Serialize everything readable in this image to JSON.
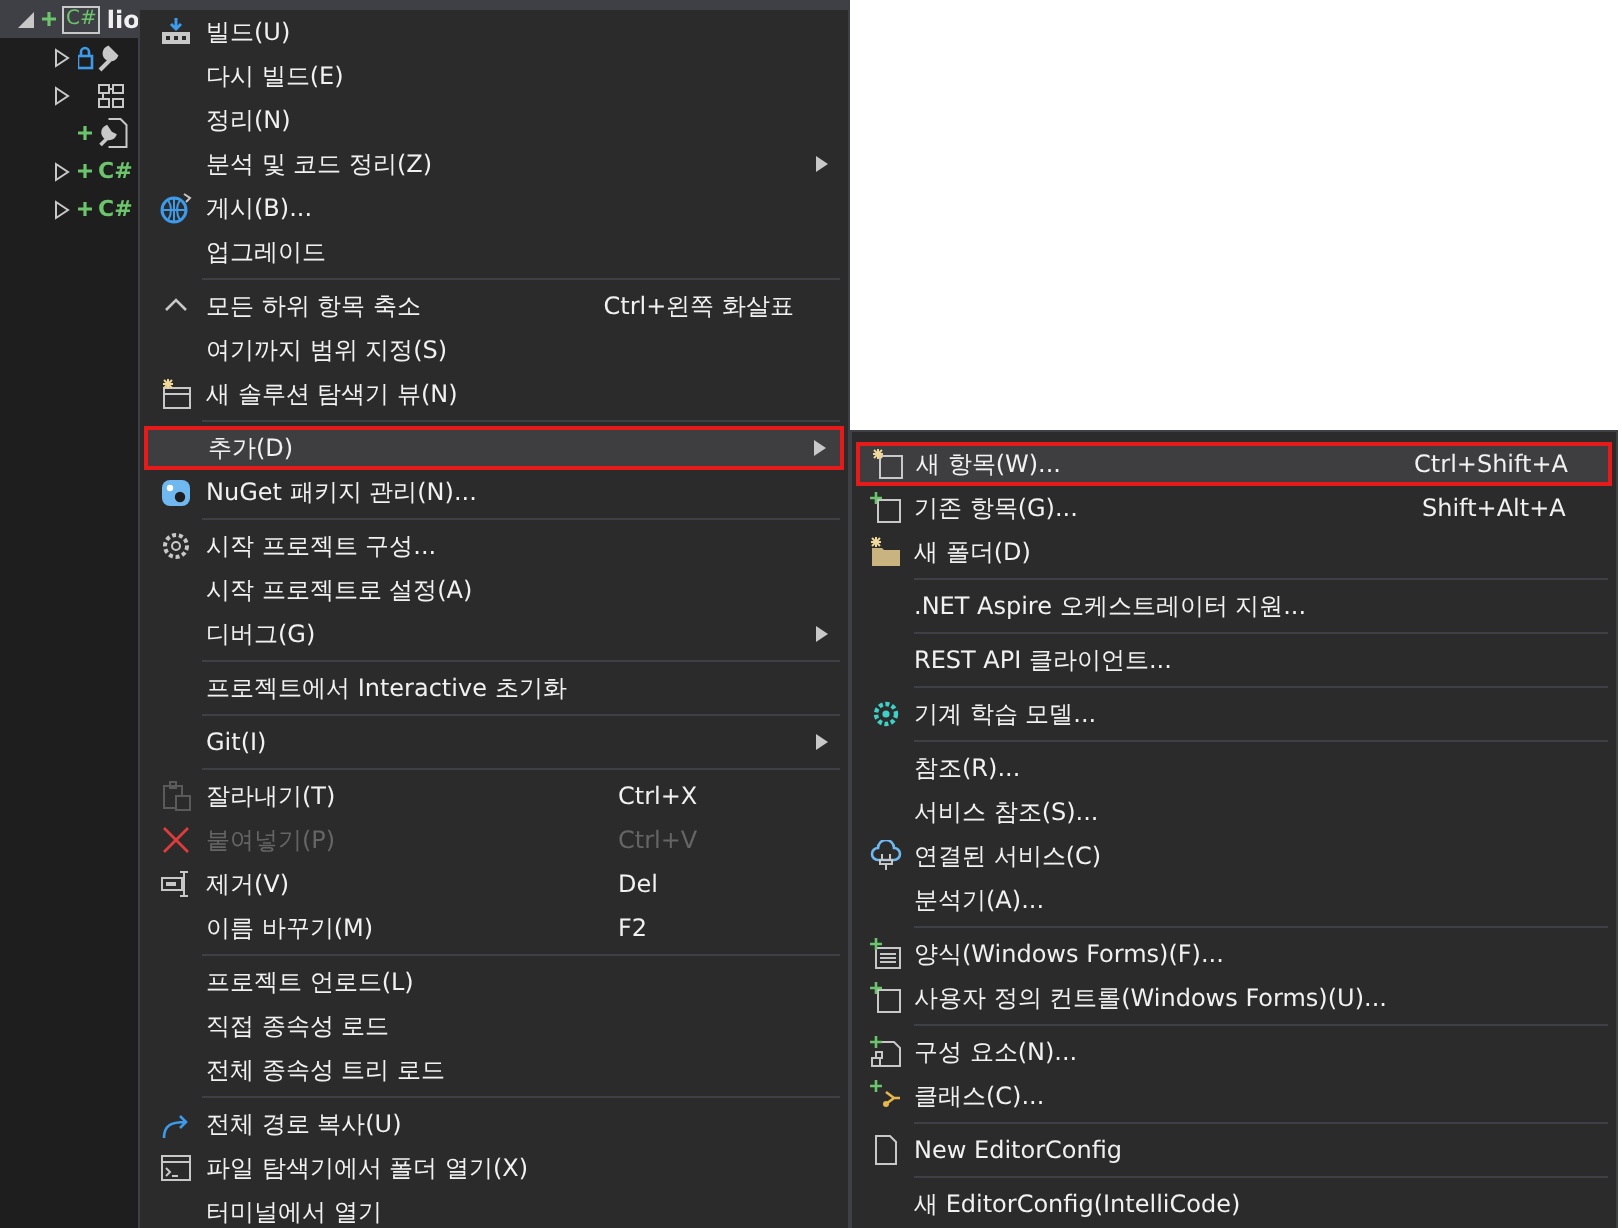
{
  "tree": [
    {
      "kind": "project",
      "badge": "C#",
      "label": "lio",
      "expanded": true,
      "selected": true,
      "children": [
        {
          "kind": "properties",
          "expanded": false
        },
        {
          "kind": "dependencies",
          "expanded": false
        },
        {
          "kind": "settings"
        },
        {
          "kind": "code",
          "badge": "C#",
          "expanded": false
        },
        {
          "kind": "code",
          "badge": "C#",
          "expanded": false
        }
      ]
    }
  ],
  "context_menu": {
    "items": [
      {
        "kind": "item",
        "label": "빌드(U)",
        "selected": false,
        "outlined": false,
        "disabled": false
      },
      {
        "kind": "item",
        "label": "다시 빌드(E)",
        "selected": false,
        "outlined": false,
        "disabled": false
      },
      {
        "kind": "item",
        "label": "정리(N)",
        "selected": false,
        "outlined": false,
        "disabled": false
      },
      {
        "kind": "item",
        "label": "분석 및 코드 정리(Z)",
        "submenu": true,
        "selected": false,
        "outlined": false,
        "disabled": false
      },
      {
        "kind": "item",
        "label": "게시(B)...",
        "selected": false,
        "outlined": false,
        "disabled": false
      },
      {
        "kind": "item",
        "label": "업그레이드",
        "selected": false,
        "outlined": false,
        "disabled": false
      },
      {
        "kind": "separator"
      },
      {
        "kind": "item",
        "label": "모든 하위 항목 축소",
        "shortcut": "Ctrl+왼쪽 화살표",
        "selected": false,
        "outlined": false,
        "disabled": false
      },
      {
        "kind": "item",
        "label": "여기까지 범위 지정(S)",
        "selected": false,
        "outlined": false,
        "disabled": false
      },
      {
        "kind": "item",
        "label": "새 솔루션 탐색기 뷰(N)",
        "selected": false,
        "outlined": false,
        "disabled": false
      },
      {
        "kind": "separator"
      },
      {
        "kind": "item",
        "label": "추가(D)",
        "submenu": true,
        "selected": true,
        "outlined": true,
        "disabled": false
      },
      {
        "kind": "item",
        "label": "NuGet 패키지 관리(N)...",
        "selected": false,
        "outlined": false,
        "disabled": false
      },
      {
        "kind": "separator"
      },
      {
        "kind": "item",
        "label": "시작 프로젝트 구성...",
        "selected": false,
        "outlined": false,
        "disabled": false
      },
      {
        "kind": "item",
        "label": "시작 프로젝트로 설정(A)",
        "selected": false,
        "outlined": false,
        "disabled": false
      },
      {
        "kind": "item",
        "label": "디버그(G)",
        "submenu": true,
        "selected": false,
        "outlined": false,
        "disabled": false
      },
      {
        "kind": "separator"
      },
      {
        "kind": "item",
        "label": "프로젝트에서 Interactive 초기화",
        "selected": false,
        "outlined": false,
        "disabled": false
      },
      {
        "kind": "separator"
      },
      {
        "kind": "item",
        "label": "Git(I)",
        "submenu": true,
        "selected": false,
        "outlined": false,
        "disabled": false
      },
      {
        "kind": "separator"
      },
      {
        "kind": "item",
        "label": "잘라내기(T)",
        "shortcut": "Ctrl+X",
        "selected": false,
        "outlined": false,
        "disabled": false
      },
      {
        "kind": "item",
        "label": "붙여넣기(P)",
        "shortcut": "Ctrl+V",
        "selected": false,
        "outlined": false,
        "disabled": true
      },
      {
        "kind": "item",
        "label": "제거(V)",
        "shortcut": "Del",
        "selected": false,
        "outlined": false,
        "disabled": false
      },
      {
        "kind": "item",
        "label": "이름 바꾸기(M)",
        "shortcut": "F2",
        "selected": false,
        "outlined": false,
        "disabled": false
      },
      {
        "kind": "separator"
      },
      {
        "kind": "item",
        "label": "프로젝트 언로드(L)",
        "selected": false,
        "outlined": false,
        "disabled": false
      },
      {
        "kind": "item",
        "label": "직접 종속성 로드",
        "selected": false,
        "outlined": false,
        "disabled": false
      },
      {
        "kind": "item",
        "label": "전체 종속성 트리 로드",
        "selected": false,
        "outlined": false,
        "disabled": false
      },
      {
        "kind": "separator"
      },
      {
        "kind": "item",
        "label": "전체 경로 복사(U)",
        "selected": false,
        "outlined": false,
        "disabled": false
      },
      {
        "kind": "item",
        "label": "파일 탐색기에서 폴더 열기(X)",
        "selected": false,
        "outlined": false,
        "disabled": false
      },
      {
        "kind": "item",
        "label": "터미널에서 열기",
        "selected": false,
        "outlined": false,
        "disabled": false
      }
    ]
  },
  "submenu": {
    "items": [
      {
        "kind": "item",
        "label": "새 항목(W)...",
        "shortcut": "Ctrl+Shift+A",
        "selected": true,
        "outlined": true,
        "disabled": false
      },
      {
        "kind": "item",
        "label": "기존 항목(G)...",
        "shortcut": "Shift+Alt+A",
        "selected": false,
        "outlined": false,
        "disabled": false
      },
      {
        "kind": "item",
        "label": "새 폴더(D)",
        "selected": false,
        "outlined": false,
        "disabled": false
      },
      {
        "kind": "separator"
      },
      {
        "kind": "item",
        "label": ".NET Aspire 오케스트레이터 지원...",
        "selected": false,
        "outlined": false,
        "disabled": false
      },
      {
        "kind": "separator"
      },
      {
        "kind": "item",
        "label": "REST API 클라이언트...",
        "selected": false,
        "outlined": false,
        "disabled": false
      },
      {
        "kind": "separator"
      },
      {
        "kind": "item",
        "label": "기계 학습 모델...",
        "selected": false,
        "outlined": false,
        "disabled": false
      },
      {
        "kind": "separator"
      },
      {
        "kind": "item",
        "label": "참조(R)...",
        "selected": false,
        "outlined": false,
        "disabled": false
      },
      {
        "kind": "item",
        "label": "서비스 참조(S)...",
        "selected": false,
        "outlined": false,
        "disabled": false
      },
      {
        "kind": "item",
        "label": "연결된 서비스(C)",
        "selected": false,
        "outlined": false,
        "disabled": false
      },
      {
        "kind": "item",
        "label": "분석기(A)...",
        "selected": false,
        "outlined": false,
        "disabled": false
      },
      {
        "kind": "separator"
      },
      {
        "kind": "item",
        "label": "양식(Windows Forms)(F)...",
        "selected": false,
        "outlined": false,
        "disabled": false
      },
      {
        "kind": "item",
        "label": "사용자 정의 컨트롤(Windows Forms)(U)...",
        "selected": false,
        "outlined": false,
        "disabled": false
      },
      {
        "kind": "separator"
      },
      {
        "kind": "item",
        "label": "구성 요소(N)...",
        "selected": false,
        "outlined": false,
        "disabled": false
      },
      {
        "kind": "item",
        "label": "클래스(C)...",
        "selected": false,
        "outlined": false,
        "disabled": false
      },
      {
        "kind": "separator"
      },
      {
        "kind": "item",
        "label": "New EditorConfig",
        "selected": false,
        "outlined": false,
        "disabled": false
      },
      {
        "kind": "separator"
      },
      {
        "kind": "item",
        "label": "새 EditorConfig(IntelliCode)",
        "selected": false,
        "outlined": false,
        "disabled": false
      }
    ]
  }
}
